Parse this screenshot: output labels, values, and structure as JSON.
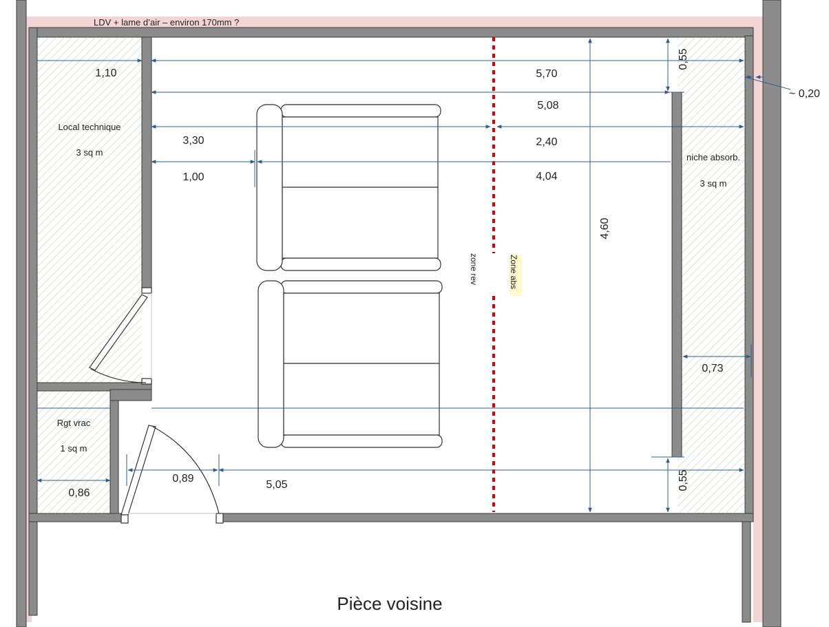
{
  "header": {
    "title": "LDV + lame d’air – environ 170mm ?"
  },
  "rooms": {
    "technical_room": {
      "name": "Local technique",
      "area": "3 sq m"
    },
    "storage_room": {
      "name": "Rgt vrac",
      "area": "1 sq m"
    },
    "absorber_niche": {
      "name": "niche absorb.",
      "area": "3 sq m"
    },
    "neighbor_room": {
      "name": "Pièce voisine"
    }
  },
  "zones": {
    "rev": "zone rev",
    "abs": "Zone abs"
  },
  "dimensions": {
    "d_1_10": "1,10",
    "d_5_70": "5,70",
    "d_5_08": "5,08",
    "d_3_30": "3,30",
    "d_2_40": "2,40",
    "d_1_00": "1,00",
    "d_4_04": "4,04",
    "d_4_60": "4,60",
    "d_0_55_top": "0,55",
    "d_0_20": "~ 0,20",
    "d_0_73": "0,73",
    "d_0_89": "0,89",
    "d_5_05": "5,05",
    "d_0_86": "0,86",
    "d_0_55_bottom": "0,55"
  },
  "colors": {
    "wall": "#8c8c8c",
    "wall_outline": "#3a3a3a",
    "insulation": "#f2d6d6",
    "dimension": "#2f5d8a",
    "hatch": "#b9d9b9",
    "zone_divider": "#e00000",
    "highlight": "#fff3a0"
  }
}
